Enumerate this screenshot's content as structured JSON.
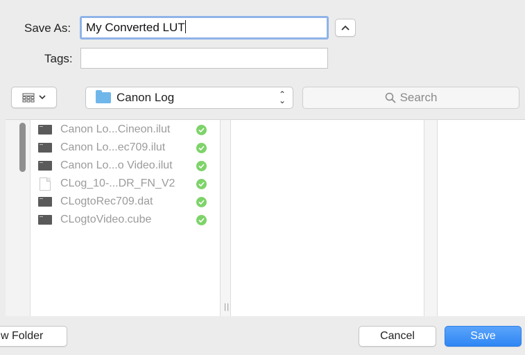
{
  "form": {
    "save_as_label": "Save As:",
    "save_as_value": "My Converted LUT",
    "tags_label": "Tags:",
    "tags_value": ""
  },
  "toolbar": {
    "location": "Canon Log",
    "search_placeholder": "Search"
  },
  "files": [
    {
      "name": "Canon Lo...Cineon.ilut",
      "icon": "document-icon",
      "synced": true
    },
    {
      "name": "Canon Lo...ec709.ilut",
      "icon": "document-icon",
      "synced": true
    },
    {
      "name": "Canon Lo...o Video.ilut",
      "icon": "document-icon",
      "synced": true
    },
    {
      "name": "CLog_10-...DR_FN_V2",
      "icon": "blank-file-icon",
      "synced": true
    },
    {
      "name": "CLogtoRec709.dat",
      "icon": "document-icon",
      "synced": true
    },
    {
      "name": "CLogtoVideo.cube",
      "icon": "document-icon",
      "synced": true
    }
  ],
  "buttons": {
    "new_folder": "w Folder",
    "cancel": "Cancel",
    "save": "Save"
  },
  "colors": {
    "accent": "#3a8ef6",
    "folder": "#6fb7ea",
    "check": "#7ed36a"
  }
}
